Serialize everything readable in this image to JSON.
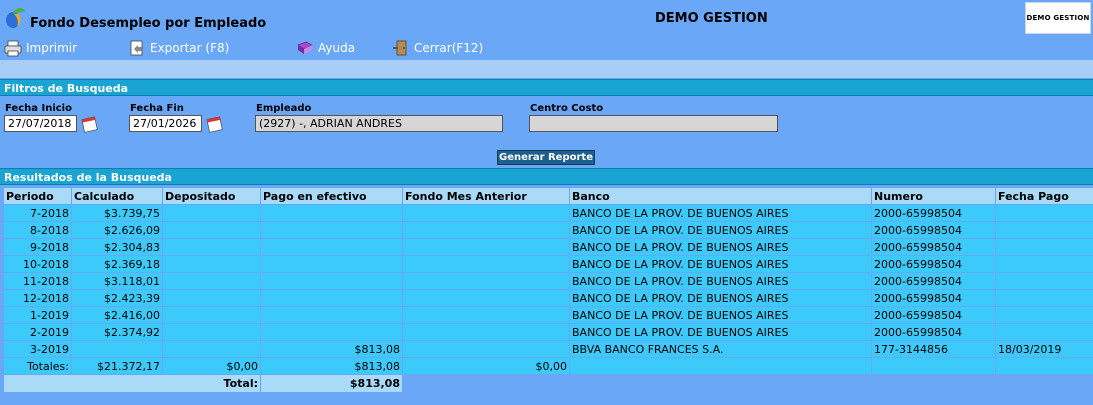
{
  "header": {
    "title": "Fondo Desempleo por Empleado",
    "company": "DEMO GESTION",
    "brand_label": "DEMO GESTION"
  },
  "toolbar": {
    "print_label": "Imprimir",
    "export_label": "Exportar (F8)",
    "help_label": "Ayuda",
    "close_label": "Cerrar(F12)"
  },
  "filters": {
    "heading": "Filtros de Busqueda",
    "start_label": "Fecha Inicio",
    "start_value": "27/07/2018",
    "end_label": "Fecha Fin",
    "end_value": "27/01/2026",
    "employee_label": "Empleado",
    "employee_value": "(2927) -, ADRIAN ANDRES",
    "cost_center_label": "Centro Costo",
    "cost_center_value": "",
    "generate_label": "Generar Reporte"
  },
  "results": {
    "heading": "Resultados de la Busqueda",
    "columns": [
      "Periodo",
      "Calculado",
      "Depositado",
      "Pago en efectivo",
      "Fondo Mes Anterior",
      "Banco",
      "Numero",
      "Fecha Pago"
    ],
    "rows": [
      [
        "7-2018",
        "$3.739,75",
        "",
        "",
        "",
        "BANCO DE LA PROV. DE BUENOS AIRES",
        "2000-65998504",
        ""
      ],
      [
        "8-2018",
        "$2.626,09",
        "",
        "",
        "",
        "BANCO DE LA PROV. DE BUENOS AIRES",
        "2000-65998504",
        ""
      ],
      [
        "9-2018",
        "$2.304,83",
        "",
        "",
        "",
        "BANCO DE LA PROV. DE BUENOS AIRES",
        "2000-65998504",
        ""
      ],
      [
        "10-2018",
        "$2.369,18",
        "",
        "",
        "",
        "BANCO DE LA PROV. DE BUENOS AIRES",
        "2000-65998504",
        ""
      ],
      [
        "11-2018",
        "$3.118,01",
        "",
        "",
        "",
        "BANCO DE LA PROV. DE BUENOS AIRES",
        "2000-65998504",
        ""
      ],
      [
        "12-2018",
        "$2.423,39",
        "",
        "",
        "",
        "BANCO DE LA PROV. DE BUENOS AIRES",
        "2000-65998504",
        ""
      ],
      [
        "1-2019",
        "$2.416,00",
        "",
        "",
        "",
        "BANCO DE LA PROV. DE BUENOS AIRES",
        "2000-65998504",
        ""
      ],
      [
        "2-2019",
        "$2.374,92",
        "",
        "",
        "",
        "BANCO DE LA PROV. DE BUENOS AIRES",
        "2000-65998504",
        ""
      ],
      [
        "3-2019",
        "",
        "",
        "$813,08",
        "",
        "BBVA BANCO FRANCES S.A.",
        "177-3144856",
        "18/03/2019"
      ]
    ],
    "totals": {
      "label": "Totales:",
      "calculado": "$21.372,17",
      "depositado": "$0,00",
      "efectivo": "$813,08",
      "fondo_anterior": "$0,00"
    },
    "grand_total": {
      "label": "Total:",
      "value": "$813,08"
    }
  }
}
